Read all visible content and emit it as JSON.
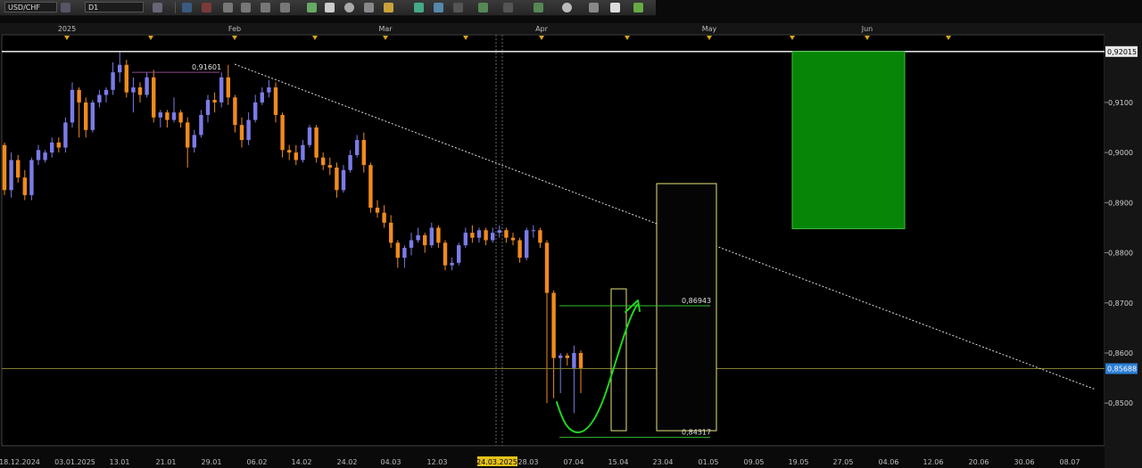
{
  "toolbar": {
    "symbol": "USD/CHF",
    "timeframe": "D1"
  },
  "chart_data": {
    "type": "candlestick",
    "symbol": "USD/CHF",
    "timeframe": "D1",
    "ylim": [
      0.8415,
      0.9235
    ],
    "y_ticks": [
      "0,9100",
      "0,9000",
      "0,8900",
      "0,8800",
      "0,8700",
      "0,8600",
      "0,8500"
    ],
    "x_ticks": [
      "18.12.2024",
      "03.01.2025",
      "13.01",
      "21.01",
      "29.01",
      "06.02",
      "14.02",
      "24.02",
      "04.03",
      "12.03",
      "24.03.2025",
      "28.03",
      "07.04",
      "15.04",
      "23.04",
      "01.05",
      "09.05",
      "19.05",
      "27.05",
      "04.06",
      "12.06",
      "20.06",
      "30.06",
      "08.07"
    ],
    "top_labels": [
      "2025",
      "Feb",
      "Mar",
      "Apr",
      "May",
      "Jun"
    ],
    "highlighted_date": "24.03.2025",
    "current_price": "0,85688",
    "resistance_label": "0,92015",
    "annotations": {
      "high_label": "0,91601",
      "target_label": "0,86943",
      "low_label": "0,84317"
    },
    "colors": {
      "bull": "#7b7be8",
      "bear": "#f08a1e",
      "trendline": "#dddddd",
      "target_zone": "#068506",
      "box_border": "#e7e37a",
      "current_price_bg": "#2b7fd6",
      "drawn_arrow": "#20d820"
    }
  }
}
